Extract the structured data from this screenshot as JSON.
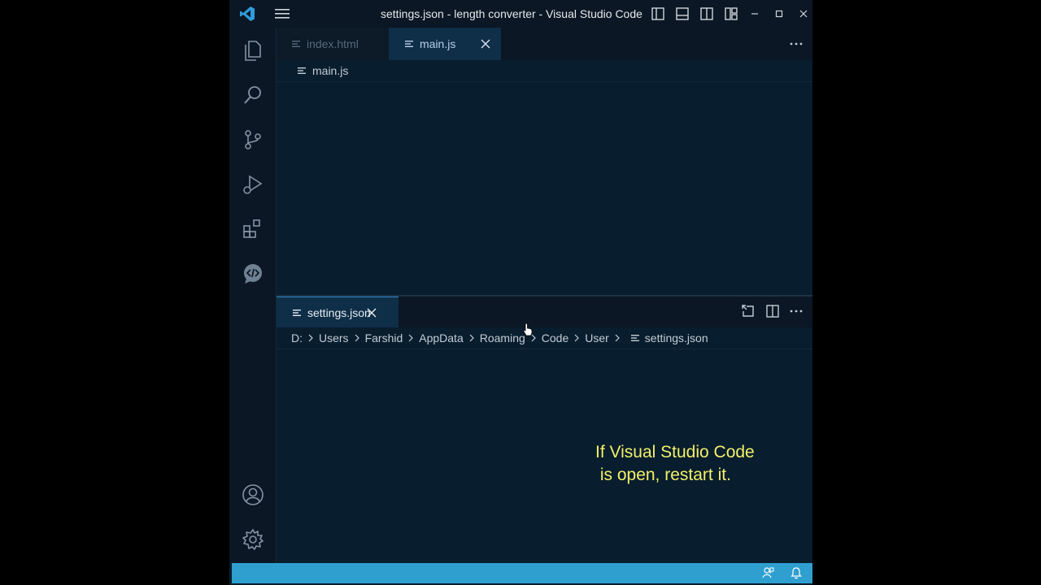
{
  "window": {
    "title": "settings.json - length converter - Visual Studio Code"
  },
  "activity_bar": {
    "items": [
      "explorer-icon",
      "search-icon",
      "source-control-icon",
      "run-debug-icon",
      "extensions-icon",
      "live-preview-icon"
    ],
    "bottom": [
      "accounts-icon",
      "manage-gear-icon"
    ]
  },
  "top_group": {
    "tabs": [
      {
        "label": "index.html",
        "active": false
      },
      {
        "label": "main.js",
        "active": true
      }
    ],
    "breadcrumb": "main.js"
  },
  "bottom_group": {
    "tab": {
      "label": "settings.json"
    },
    "breadcrumb": {
      "segments": [
        "D:",
        "Users",
        "Farshid",
        "AppData",
        "Roaming",
        "Code",
        "User"
      ],
      "file": "settings.json"
    }
  },
  "overlay": {
    "line1": "If Visual Studio Code",
    "line2": " is open, restart it."
  },
  "colors": {
    "status_bar": "#2f9fd0",
    "editor_bg": "#081d2d",
    "caption": "#f2f06a"
  }
}
